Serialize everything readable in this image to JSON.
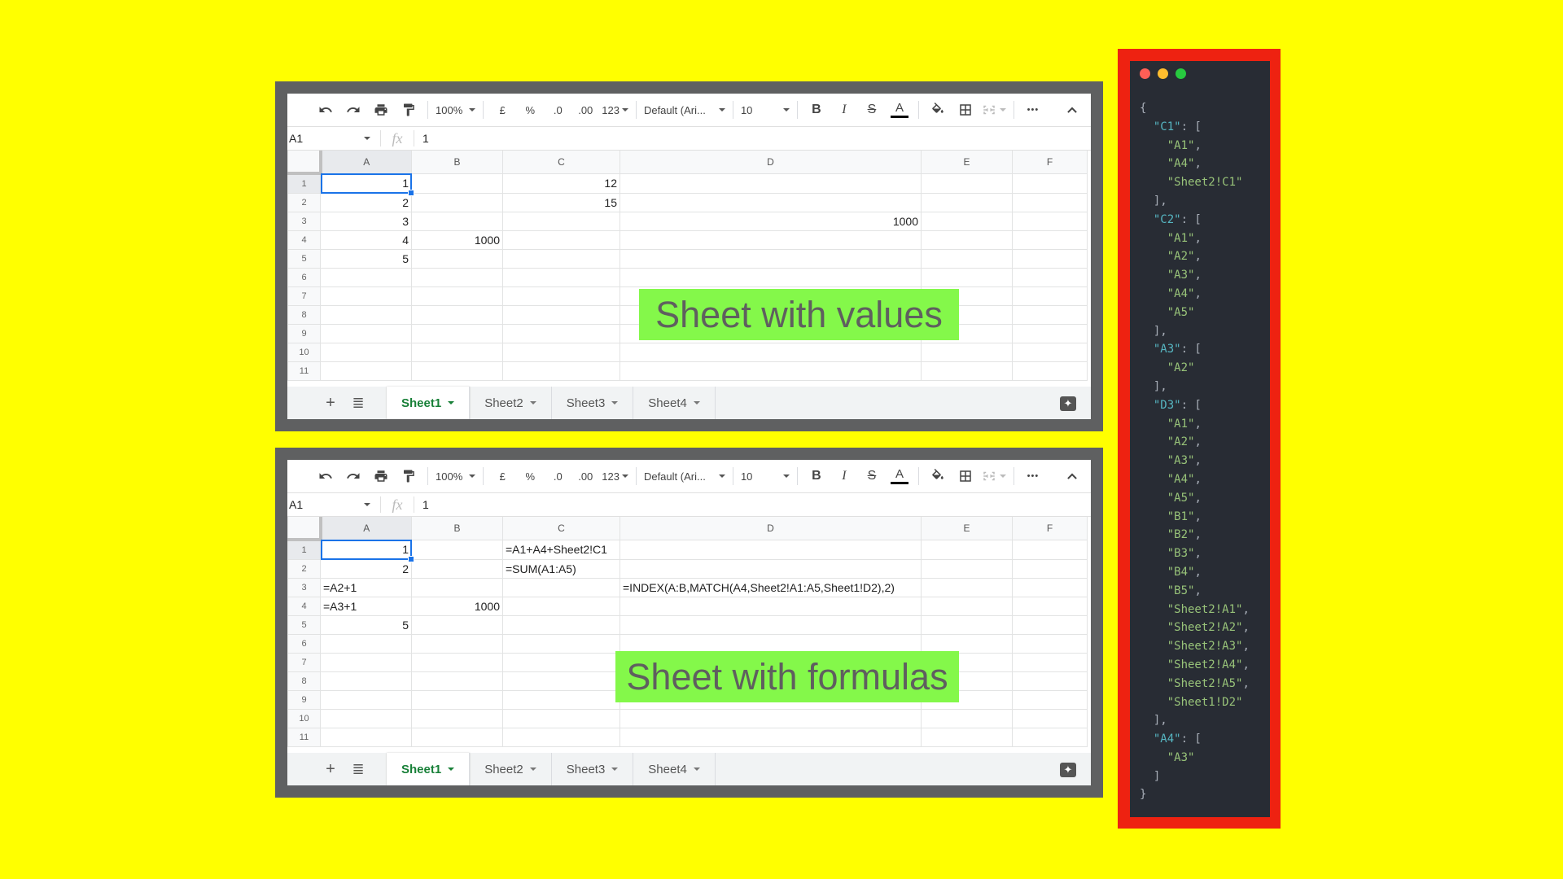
{
  "toolbar": {
    "zoom": "100%",
    "currency": "£",
    "percent": "%",
    "dec_decrease": ".0",
    "dec_increase": ".00",
    "format_more": "123",
    "font": "Default (Ari...",
    "font_size": "10",
    "bold": "B",
    "italic": "I",
    "strike": "S",
    "text_color": "A",
    "more": "•••"
  },
  "formula_bar": {
    "cell_ref": "A1",
    "fx": "fx",
    "value": "1"
  },
  "columns": [
    "A",
    "B",
    "C",
    "D",
    "E",
    "F"
  ],
  "rows": [
    "1",
    "2",
    "3",
    "4",
    "5",
    "6",
    "7",
    "8",
    "9",
    "10",
    "11"
  ],
  "sheet_values": {
    "label": "Sheet with values",
    "cells": {
      "A1": "1",
      "A2": "2",
      "A3": "3",
      "A4": "4",
      "A5": "5",
      "B4": "1000",
      "C1": "12",
      "C2": "15",
      "D3": "1000"
    }
  },
  "sheet_formulas": {
    "label": "Sheet with formulas",
    "cells": {
      "A1": "1",
      "A2": "2",
      "A3": "=A2+1",
      "A4": "=A3+1",
      "A5": "5",
      "B4": "1000",
      "C1": "=A1+A4+Sheet2!C1",
      "C2": "=SUM(A1:A5)",
      "D3": "=INDEX(A:B,MATCH(A4,Sheet2!A1:A5,Sheet1!D2),2)"
    }
  },
  "tabs": {
    "add": "+",
    "list": "≣",
    "sheets": [
      "Sheet1",
      "Sheet2",
      "Sheet3",
      "Sheet4"
    ],
    "active": "Sheet1"
  },
  "dependency_json": {
    "C1": [
      "A1",
      "A4",
      "Sheet2!C1"
    ],
    "C2": [
      "A1",
      "A2",
      "A3",
      "A4",
      "A5"
    ],
    "A3": [
      "A2"
    ],
    "D3": [
      "A1",
      "A2",
      "A3",
      "A4",
      "A5",
      "B1",
      "B2",
      "B3",
      "B4",
      "B5",
      "Sheet2!A1",
      "Sheet2!A2",
      "Sheet2!A3",
      "Sheet2!A4",
      "Sheet2!A5",
      "Sheet1!D2"
    ],
    "A4": [
      "A3"
    ]
  },
  "colors": {
    "background": "#ffff00",
    "label_bg": "#84f84a",
    "code_frame": "#ee2211",
    "code_bg": "#282c34",
    "key": "#56b6c2",
    "string": "#98c379",
    "active_tab": "#188038",
    "selection": "#1a73e8",
    "dot_red": "#ff5f56",
    "dot_yellow": "#ffbd2e",
    "dot_green": "#27c93f"
  }
}
